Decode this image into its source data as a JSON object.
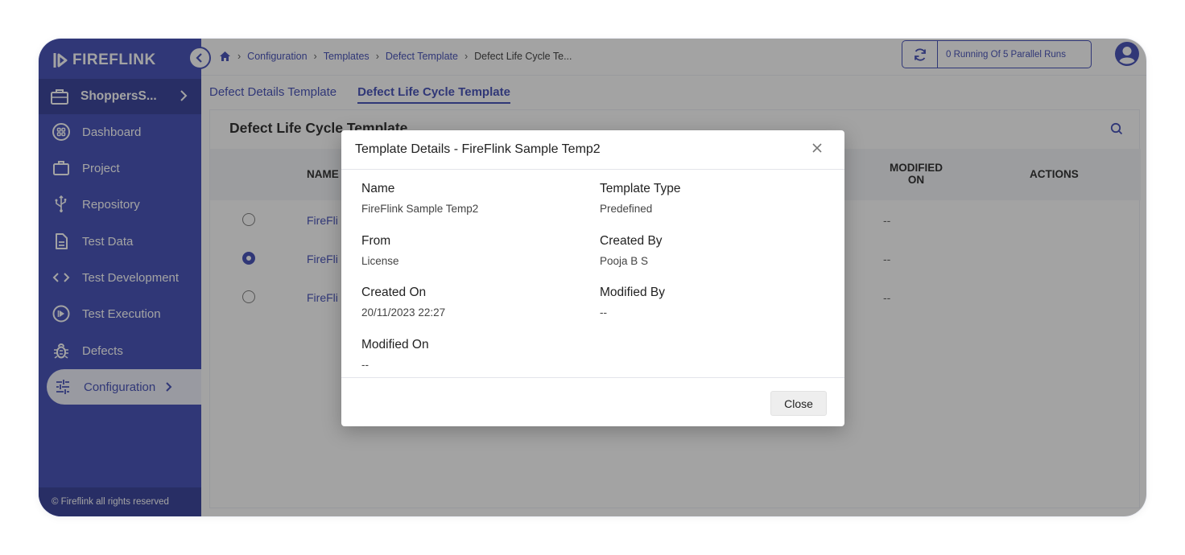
{
  "app": {
    "brand": "FIREFLINK",
    "footer": "© Fireflink all rights reserved"
  },
  "sidebar": {
    "project": "ShoppersS...",
    "items": [
      {
        "label": "Dashboard",
        "icon": "dashboard-icon"
      },
      {
        "label": "Project",
        "icon": "briefcase-icon"
      },
      {
        "label": "Repository",
        "icon": "usb-icon"
      },
      {
        "label": "Test Data",
        "icon": "file-icon"
      },
      {
        "label": "Test Development",
        "icon": "code-icon"
      },
      {
        "label": "Test Execution",
        "icon": "play-circle-icon"
      },
      {
        "label": "Defects",
        "icon": "bug-icon"
      },
      {
        "label": "Configuration",
        "icon": "sliders-icon"
      }
    ]
  },
  "breadcrumb": {
    "items": [
      "Configuration",
      "Templates",
      "Defect Template"
    ],
    "current": "Defect Life Cycle Te..."
  },
  "topbar": {
    "runs": "0 Running Of 5 Parallel Runs"
  },
  "tabs": [
    "Defect Details Template",
    "Defect Life Cycle Template"
  ],
  "content": {
    "title": "Defect Life Cycle Template",
    "columns": {
      "name": "NAME",
      "modified_on": "MODIFIED ON",
      "actions": "ACTIONS"
    },
    "rows": [
      {
        "name": "FireFli",
        "modified": "--",
        "selected": false
      },
      {
        "name": "FireFli",
        "modified": "--",
        "selected": true
      },
      {
        "name": "FireFli",
        "modified": "--",
        "selected": false
      }
    ]
  },
  "modal": {
    "title": "Template Details - FireFlink Sample Temp2",
    "fields": {
      "name": {
        "label": "Name",
        "value": "FireFlink Sample Temp2"
      },
      "template_type": {
        "label": "Template Type",
        "value": "Predefined"
      },
      "from": {
        "label": "From",
        "value": "License"
      },
      "created_by": {
        "label": "Created By",
        "value": "Pooja B S"
      },
      "created_on": {
        "label": "Created On",
        "value": "20/11/2023 22:27"
      },
      "modified_by": {
        "label": "Modified By",
        "value": "--"
      },
      "modified_on": {
        "label": "Modified On",
        "value": "--"
      }
    },
    "close_label": "Close"
  },
  "colors": {
    "primary": "#3a46b4",
    "sidebar_dark": "#2c3694"
  }
}
